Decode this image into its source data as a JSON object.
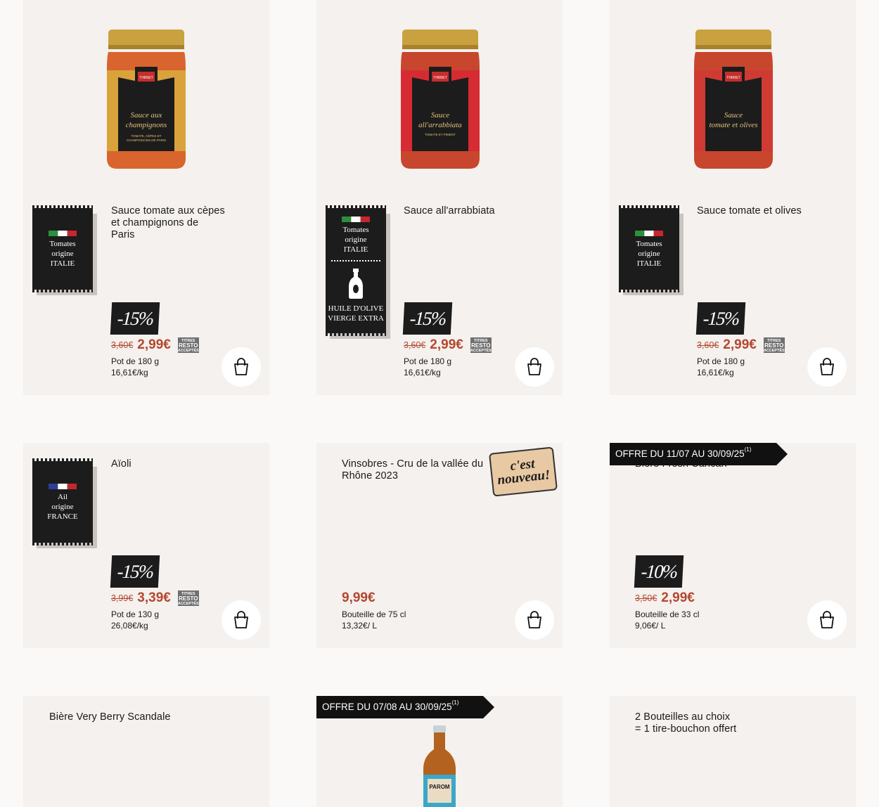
{
  "products": [
    {
      "title": "Sauce tomate aux cèpes\net champignons de\nParis",
      "origin": [
        "Tomates",
        "origine",
        "ITALIE"
      ],
      "discount": "-15%",
      "old_price": "3,60€",
      "price": "2,99€",
      "resto": [
        "TITRES",
        "RESTO",
        "ACCEPTÉS"
      ],
      "unit": "Pot de 180 g",
      "per_unit": "16,61€/kg",
      "jar_label": [
        "THIRIET",
        "Sauce aux",
        "champignons",
        "TOMATE, CÈPES ET",
        "CHAMPIGNONS DE PARIS"
      ]
    },
    {
      "title": "Sauce all'arrabbiata",
      "origin": [
        "Tomates",
        "origine",
        "ITALIE"
      ],
      "origin2": [
        "HUILE D'OLIVE",
        "VIERGE EXTRA"
      ],
      "discount": "-15%",
      "old_price": "3,60€",
      "price": "2,99€",
      "resto": [
        "TITRES",
        "RESTO",
        "ACCEPTÉS"
      ],
      "unit": "Pot de 180 g",
      "per_unit": "16,61€/kg",
      "jar_label": [
        "THIRIET",
        "Sauce",
        "all'arrabbiata",
        "TOMATE ET PIMENT"
      ]
    },
    {
      "title": "Sauce tomate et olives",
      "origin": [
        "Tomates",
        "origine",
        "ITALIE"
      ],
      "discount": "-15%",
      "old_price": "3,60€",
      "price": "2,99€",
      "resto": [
        "TITRES",
        "RESTO",
        "ACCEPTÉS"
      ],
      "unit": "Pot de 180 g",
      "per_unit": "16,61€/kg",
      "jar_label": [
        "THIRIET",
        "Sauce",
        "tomate et olives"
      ]
    },
    {
      "title": "Aïoli",
      "origin": [
        "Ail",
        "origine",
        "FRANCE"
      ],
      "discount": "-15%",
      "old_price": "3,99€",
      "price": "3,39€",
      "resto": [
        "TITRES",
        "RESTO",
        "ACCEPTÉS"
      ],
      "unit": "Pot de 130 g",
      "per_unit": "26,08€/kg"
    },
    {
      "title": "Vinsobres - Cru de la vallée du\nRhône 2023",
      "badge": [
        "c'est",
        "nouveau!"
      ],
      "price": "9,99€",
      "unit": "Bouteille de 75 cl",
      "per_unit": "13,32€/ L"
    },
    {
      "title": "Bière Fresh Cancan",
      "offer": "OFFRE DU 11/07 AU 30/09/25",
      "offer_note": "(1)",
      "discount": "-10%",
      "old_price": "3,50€",
      "price": "2,99€",
      "unit": "Bouteille de 33 cl",
      "per_unit": "9,06€/ L"
    },
    {
      "title": "Bière Very Berry Scandale"
    },
    {
      "offer": "OFFRE DU 07/08 AU 30/09/25",
      "offer_note": "(1)",
      "bottle_label": "PAROM"
    },
    {
      "title": "2 Bouteilles au choix\n= 1 tire-bouchon offert"
    }
  ],
  "colors": {
    "price": "#b5472e",
    "card": "#f4f1ee",
    "tag": "#1c1c1c"
  },
  "icons": {
    "cart": "shopping-bag-icon"
  }
}
